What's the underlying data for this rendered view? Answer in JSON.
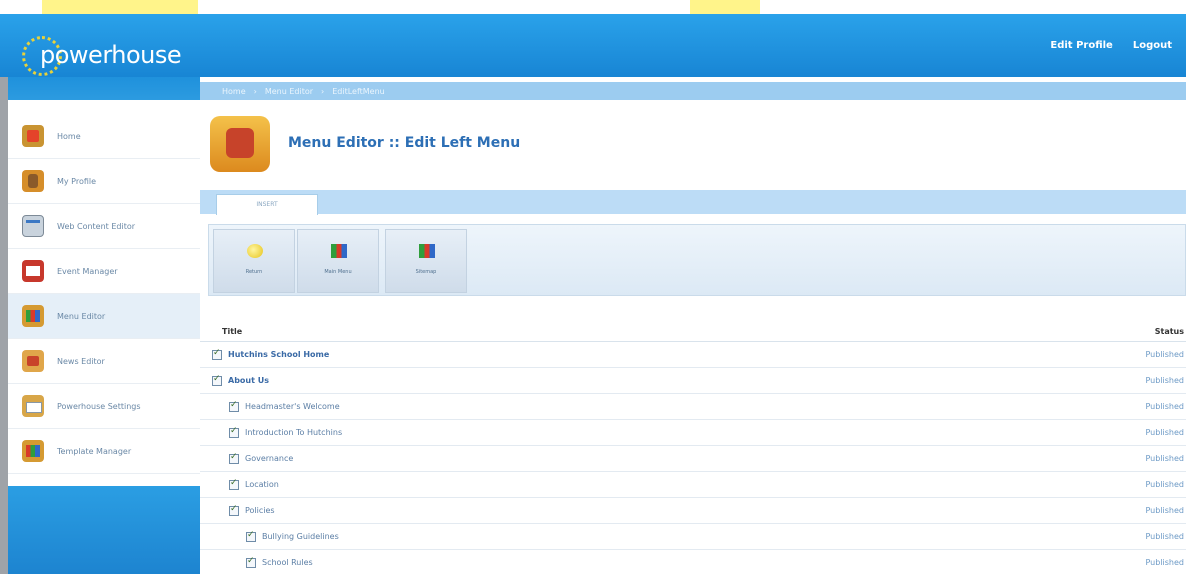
{
  "header": {
    "logo_text": "powerhouse",
    "links": [
      "Edit Profile",
      "Logout"
    ]
  },
  "breadcrumb": [
    "Home",
    "Menu Editor",
    "EditLeftMenu"
  ],
  "sidebar": {
    "items": [
      {
        "label": "Home",
        "icon": "home-icon"
      },
      {
        "label": "My Profile",
        "icon": "profile-icon"
      },
      {
        "label": "Web Content Editor",
        "icon": "web-content-icon"
      },
      {
        "label": "Event Manager",
        "icon": "calendar-icon"
      },
      {
        "label": "Menu Editor",
        "icon": "menu-grid-icon",
        "active": true
      },
      {
        "label": "News Editor",
        "icon": "news-icon"
      },
      {
        "label": "Powerhouse Settings",
        "icon": "settings-icon"
      },
      {
        "label": "Template Manager",
        "icon": "template-icon"
      }
    ]
  },
  "main": {
    "page_title": "Menu Editor :: Edit Left Menu",
    "tab_label": "INSERT",
    "ribbon": [
      "Return",
      "Main Menu",
      "Sitemap"
    ],
    "table": {
      "columns": {
        "title": "Title",
        "status": "Status"
      },
      "rows": [
        {
          "title": "Hutchins School Home",
          "status": "Published",
          "level": 0
        },
        {
          "title": "About Us",
          "status": "Published",
          "level": 0
        },
        {
          "title": "Headmaster's Welcome",
          "status": "Published",
          "level": 1
        },
        {
          "title": "Introduction To Hutchins",
          "status": "Published",
          "level": 1
        },
        {
          "title": "Governance",
          "status": "Published",
          "level": 1
        },
        {
          "title": "Location",
          "status": "Published",
          "level": 1
        },
        {
          "title": "Policies",
          "status": "Published",
          "level": 1
        },
        {
          "title": "Bullying Guidelines",
          "status": "Published",
          "level": 2
        },
        {
          "title": "School Rules",
          "status": "Published",
          "level": 2
        }
      ]
    }
  },
  "colors": {
    "header_blue": "#1f8ed8",
    "title_blue": "#2d6fb5",
    "status_blue": "#6d9ac6"
  }
}
